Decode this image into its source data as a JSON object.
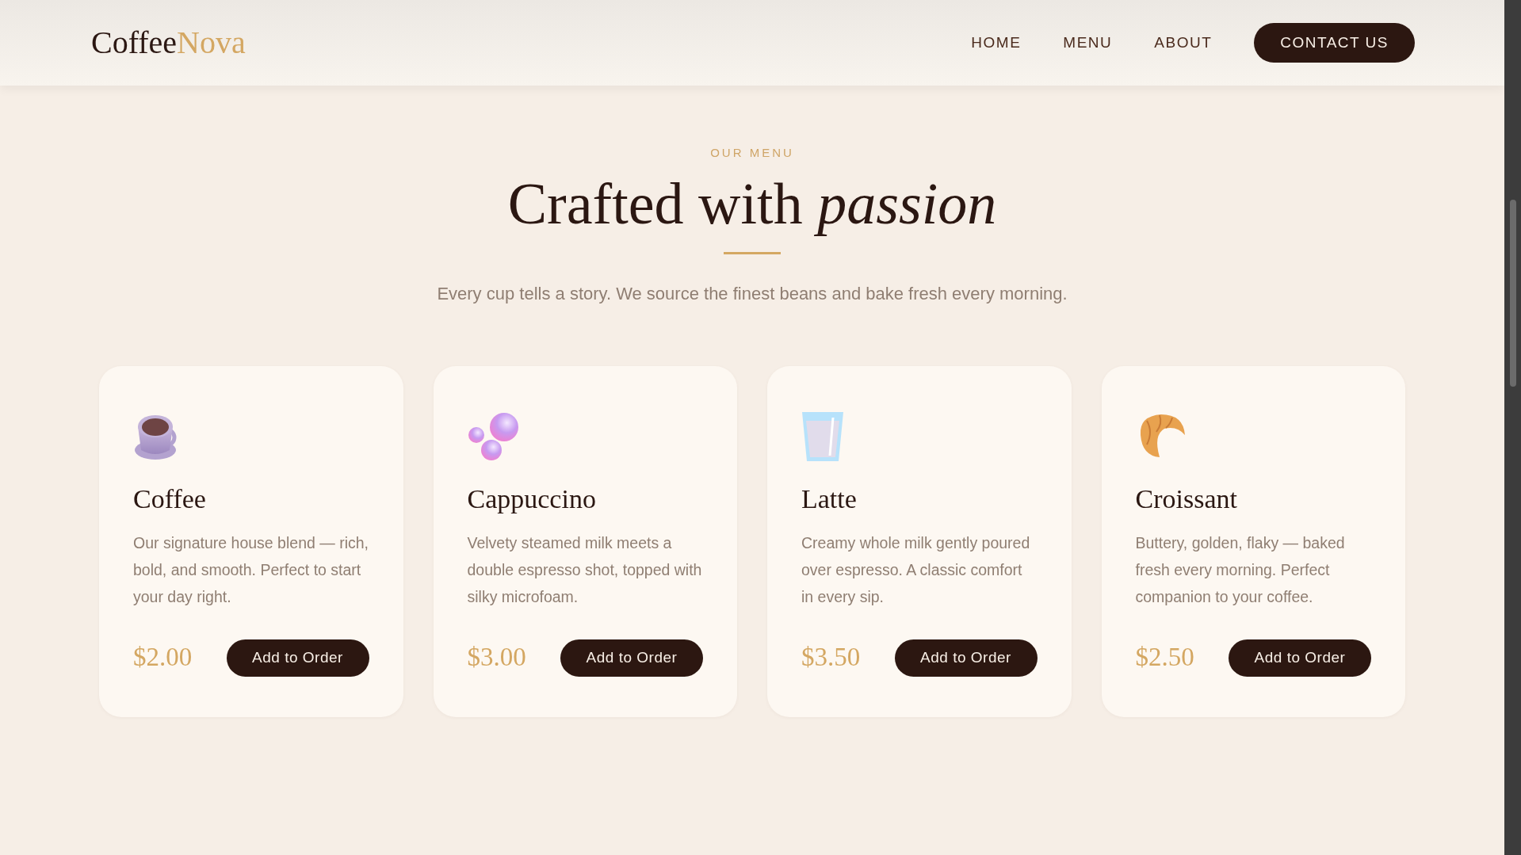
{
  "header": {
    "logo": {
      "text": "Coffee",
      "accent": "Nova"
    },
    "nav": [
      "HOME",
      "MENU",
      "ABOUT"
    ],
    "cta": "CONTACT US"
  },
  "menu_section": {
    "eyebrow": "OUR MENU",
    "heading": "Crafted with *passion*",
    "intro": "Every cup tells a story. We source the finest beans and bake fresh every morning.",
    "items": [
      {
        "name": "Coffee",
        "description": "Our signature house blend — rich, bold, and smooth. Perfect to start your day right.",
        "price": "$2.00",
        "button": "Add to Order"
      },
      {
        "name": "Cappuccino",
        "description": "Velvety steamed milk meets a double espresso shot, topped with silky microfoam.",
        "price": "$3.00",
        "button": "Add to Order"
      },
      {
        "name": "Latte",
        "description": "Creamy whole milk gently poured over espresso. A classic comfort in every sip.",
        "price": "$3.50",
        "button": "Add to Order"
      },
      {
        "name": "Croissant",
        "description": "Buttery, golden, flaky — baked fresh every morning. Perfect companion to your coffee.",
        "price": "$2.50",
        "button": "Add to Order"
      }
    ]
  }
}
